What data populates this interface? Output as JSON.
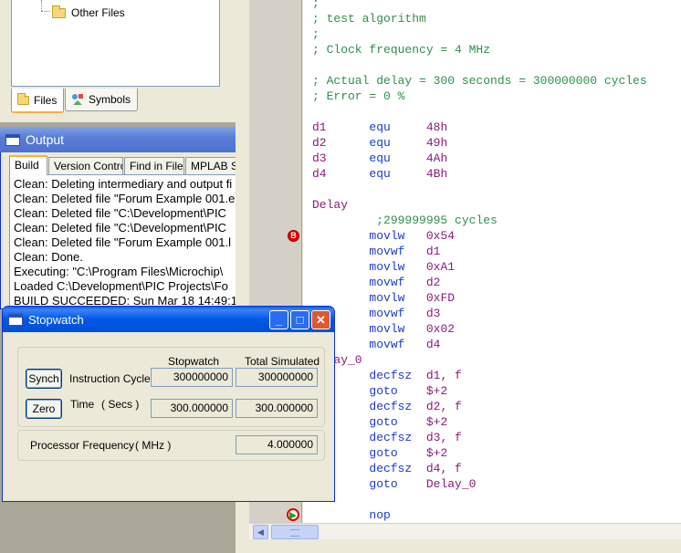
{
  "project_tree": {
    "folder_label": "Other Files",
    "tabs": [
      {
        "label": "Files",
        "icon": "folder-icon"
      },
      {
        "label": "Symbols",
        "icon": "symbols-icon"
      }
    ]
  },
  "output": {
    "title": "Output",
    "tabs": [
      "Build",
      "Version Control",
      "Find in Files",
      "MPLAB SI"
    ],
    "lines": [
      "Clean: Deleting intermediary and output fi",
      "Clean: Deleted file \"Forum Example 001.e",
      "Clean: Deleted file \"C:\\Development\\PIC",
      "Clean: Deleted file \"C:\\Development\\PIC",
      "Clean: Deleted file \"Forum Example 001.l",
      "Clean: Done.",
      "Executing: \"C:\\Program Files\\Microchip\\",
      "Loaded C:\\Development\\PIC Projects\\Fo",
      "BUILD SUCCEEDED: Sun Mar 18 14:49:1"
    ]
  },
  "editor": {
    "lines": [
      {
        "tokens": [
          {
            "t": ";",
            "c": "c-comment"
          }
        ]
      },
      {
        "tokens": [
          {
            "t": "; test algorithm",
            "c": "c-comment"
          }
        ]
      },
      {
        "tokens": [
          {
            "t": ";",
            "c": "c-comment"
          }
        ]
      },
      {
        "tokens": [
          {
            "t": "; Clock frequency = 4 MHz",
            "c": "c-comment"
          }
        ]
      },
      {
        "tokens": []
      },
      {
        "tokens": [
          {
            "t": "; Actual delay = 300 seconds = 300000000 cycles",
            "c": "c-comment"
          }
        ]
      },
      {
        "tokens": [
          {
            "t": "; Error = 0 %",
            "c": "c-comment"
          }
        ]
      },
      {
        "tokens": []
      },
      {
        "tokens": [
          {
            "t": "d1      ",
            "c": "c-label"
          },
          {
            "t": "equ     ",
            "c": "c-kw"
          },
          {
            "t": "48h",
            "c": "c-op"
          }
        ]
      },
      {
        "tokens": [
          {
            "t": "d2      ",
            "c": "c-label"
          },
          {
            "t": "equ     ",
            "c": "c-kw"
          },
          {
            "t": "49h",
            "c": "c-op"
          }
        ]
      },
      {
        "tokens": [
          {
            "t": "d3      ",
            "c": "c-label"
          },
          {
            "t": "equ     ",
            "c": "c-kw"
          },
          {
            "t": "4Ah",
            "c": "c-op"
          }
        ]
      },
      {
        "tokens": [
          {
            "t": "d4      ",
            "c": "c-label"
          },
          {
            "t": "equ     ",
            "c": "c-kw"
          },
          {
            "t": "4Bh",
            "c": "c-op"
          }
        ]
      },
      {
        "tokens": []
      },
      {
        "tokens": [
          {
            "t": "Delay",
            "c": "c-label"
          }
        ]
      },
      {
        "tokens": [
          {
            "t": "         ;299999995 cycles",
            "c": "c-comment"
          }
        ]
      },
      {
        "tokens": [
          {
            "t": "        ",
            "c": ""
          },
          {
            "t": "movlw   ",
            "c": "c-kw"
          },
          {
            "t": "0x54",
            "c": "c-op"
          }
        ]
      },
      {
        "tokens": [
          {
            "t": "        ",
            "c": ""
          },
          {
            "t": "movwf   ",
            "c": "c-kw"
          },
          {
            "t": "d1",
            "c": "c-op"
          }
        ]
      },
      {
        "tokens": [
          {
            "t": "        ",
            "c": ""
          },
          {
            "t": "movlw   ",
            "c": "c-kw"
          },
          {
            "t": "0xA1",
            "c": "c-op"
          }
        ]
      },
      {
        "tokens": [
          {
            "t": "        ",
            "c": ""
          },
          {
            "t": "movwf   ",
            "c": "c-kw"
          },
          {
            "t": "d2",
            "c": "c-op"
          }
        ]
      },
      {
        "tokens": [
          {
            "t": "        ",
            "c": ""
          },
          {
            "t": "movlw   ",
            "c": "c-kw"
          },
          {
            "t": "0xFD",
            "c": "c-op"
          }
        ]
      },
      {
        "tokens": [
          {
            "t": "        ",
            "c": ""
          },
          {
            "t": "movwf   ",
            "c": "c-kw"
          },
          {
            "t": "d3",
            "c": "c-op"
          }
        ]
      },
      {
        "tokens": [
          {
            "t": "        ",
            "c": ""
          },
          {
            "t": "movlw   ",
            "c": "c-kw"
          },
          {
            "t": "0x02",
            "c": "c-op"
          }
        ]
      },
      {
        "tokens": [
          {
            "t": "        ",
            "c": ""
          },
          {
            "t": "movwf   ",
            "c": "c-kw"
          },
          {
            "t": "d4",
            "c": "c-op"
          }
        ]
      },
      {
        "tokens": [
          {
            "t": "Delay_0",
            "c": "c-label"
          }
        ]
      },
      {
        "tokens": [
          {
            "t": "        ",
            "c": ""
          },
          {
            "t": "decfsz  ",
            "c": "c-kw"
          },
          {
            "t": "d1, f",
            "c": "c-op"
          }
        ]
      },
      {
        "tokens": [
          {
            "t": "        ",
            "c": ""
          },
          {
            "t": "goto    ",
            "c": "c-kw"
          },
          {
            "t": "$+2",
            "c": "c-op"
          }
        ]
      },
      {
        "tokens": [
          {
            "t": "        ",
            "c": ""
          },
          {
            "t": "decfsz  ",
            "c": "c-kw"
          },
          {
            "t": "d2, f",
            "c": "c-op"
          }
        ]
      },
      {
        "tokens": [
          {
            "t": "        ",
            "c": ""
          },
          {
            "t": "goto    ",
            "c": "c-kw"
          },
          {
            "t": "$+2",
            "c": "c-op"
          }
        ]
      },
      {
        "tokens": [
          {
            "t": "        ",
            "c": ""
          },
          {
            "t": "decfsz  ",
            "c": "c-kw"
          },
          {
            "t": "d3, f",
            "c": "c-op"
          }
        ]
      },
      {
        "tokens": [
          {
            "t": "        ",
            "c": ""
          },
          {
            "t": "goto    ",
            "c": "c-kw"
          },
          {
            "t": "$+2",
            "c": "c-op"
          }
        ]
      },
      {
        "tokens": [
          {
            "t": "        ",
            "c": ""
          },
          {
            "t": "decfsz  ",
            "c": "c-kw"
          },
          {
            "t": "d4, f",
            "c": "c-op"
          }
        ]
      },
      {
        "tokens": [
          {
            "t": "        ",
            "c": ""
          },
          {
            "t": "goto    ",
            "c": "c-kw"
          },
          {
            "t": "Delay_0",
            "c": "c-op"
          }
        ]
      },
      {
        "tokens": []
      },
      {
        "tokens": [
          {
            "t": "        ",
            "c": ""
          },
          {
            "t": "nop",
            "c": "c-kw"
          }
        ]
      }
    ],
    "breakpoint_line_index": 15,
    "pc_line_index": 33,
    "breakpoint_glyph": "B"
  },
  "stopwatch": {
    "title": "Stopwatch",
    "col_stopwatch": "Stopwatch",
    "col_total": "Total Simulated",
    "synch_label": "Synch",
    "zero_label": "Zero",
    "instr_label": "Instruction  Cycles",
    "time_label": "Time",
    "time_unit": "( Secs )",
    "instr_stopwatch": "300000000",
    "instr_total": "300000000",
    "time_stopwatch": "300.000000",
    "time_total": "300.000000",
    "freq_label": "Processor Frequency",
    "freq_unit": "( MHz )",
    "freq_value": "4.000000"
  },
  "colors": {
    "title_active": "#0058e6",
    "title_inactive": "#7fa2e6",
    "comment": "#2f8f4f",
    "keyword": "#1a3ad6",
    "label": "#8b1a7a"
  }
}
